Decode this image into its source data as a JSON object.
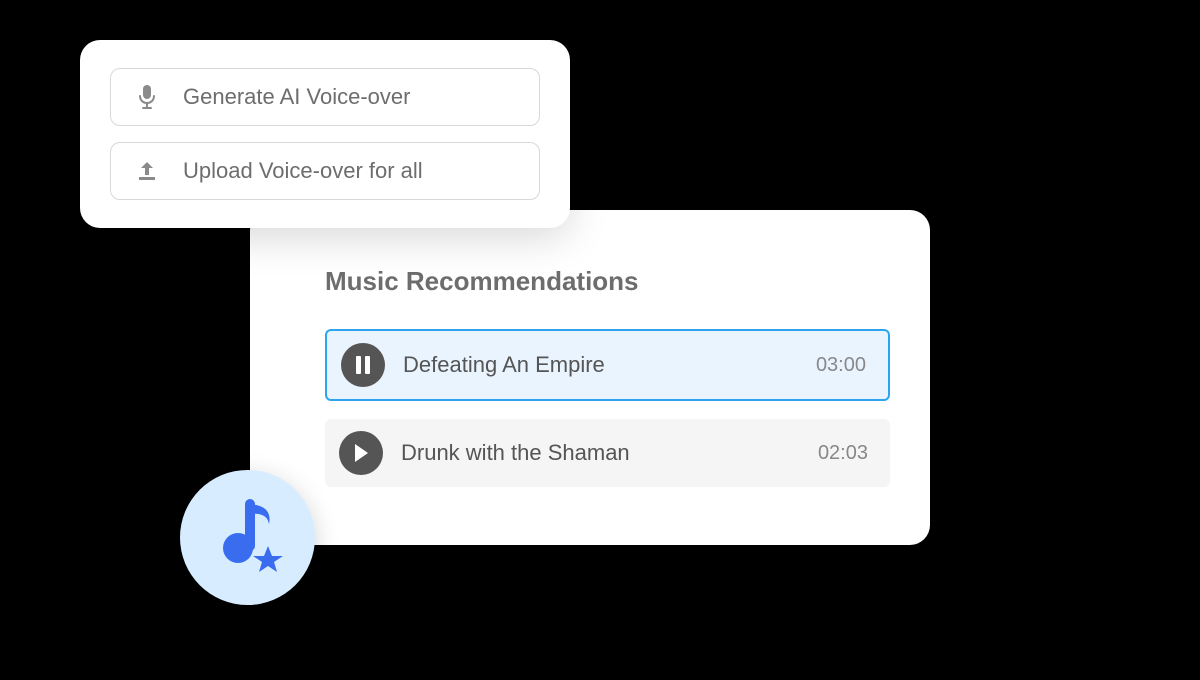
{
  "voiceover": {
    "generate_label": "Generate AI Voice-over",
    "upload_label": "Upload Voice-over for all"
  },
  "music": {
    "heading": "Music Recommendations",
    "tracks": [
      {
        "title": "Defeating An Empire",
        "duration": "03:00",
        "state": "playing"
      },
      {
        "title": "Drunk with the Shaman",
        "duration": "02:03",
        "state": "paused"
      }
    ]
  },
  "colors": {
    "accent_blue": "#2ea4f1",
    "badge_bg": "#d7ecff",
    "note_blue": "#3a6cf0"
  }
}
